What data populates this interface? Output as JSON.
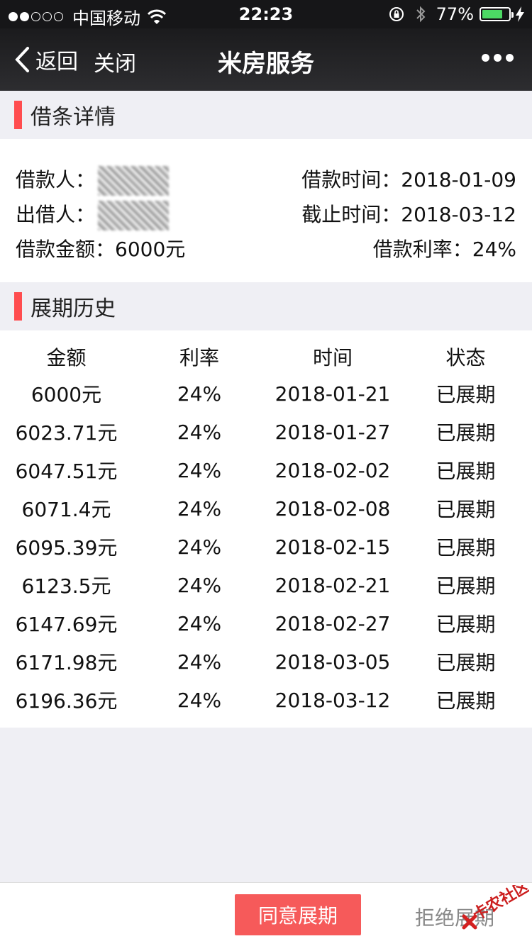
{
  "status_bar": {
    "carrier": "中国移动",
    "time": "22:23",
    "battery_percent": "77%",
    "battery_level": 0.77,
    "signal_strength": 2
  },
  "nav": {
    "back_label": "返回",
    "close_label": "关闭",
    "title": "米房服务",
    "more_icon": "more-icon"
  },
  "loan_detail": {
    "section_title": "借条详情",
    "borrower_label": "借款人：",
    "lender_label": "出借人：",
    "amount_label": "借款金额：",
    "amount_value": "6000元",
    "loan_time_label": "借款时间：",
    "loan_time_value": "2018-01-09",
    "deadline_label": "截止时间：",
    "deadline_value": "2018-03-12",
    "rate_label": "借款利率：",
    "rate_value": "24%"
  },
  "history": {
    "section_title": "展期历史",
    "columns": [
      "金额",
      "利率",
      "时间",
      "状态"
    ],
    "rows": [
      [
        "6000元",
        "24%",
        "2018-01-21",
        "已展期"
      ],
      [
        "6023.71元",
        "24%",
        "2018-01-27",
        "已展期"
      ],
      [
        "6047.51元",
        "24%",
        "2018-02-02",
        "已展期"
      ],
      [
        "6071.4元",
        "24%",
        "2018-02-08",
        "已展期"
      ],
      [
        "6095.39元",
        "24%",
        "2018-02-15",
        "已展期"
      ],
      [
        "6123.5元",
        "24%",
        "2018-02-21",
        "已展期"
      ],
      [
        "6147.69元",
        "24%",
        "2018-02-27",
        "已展期"
      ],
      [
        "6171.98元",
        "24%",
        "2018-03-05",
        "已展期"
      ],
      [
        "6196.36元",
        "24%",
        "2018-03-12",
        "已展期"
      ]
    ]
  },
  "actions": {
    "agree_label": "同意展期",
    "reject_label": "拒绝展期"
  },
  "watermark": {
    "text": "卡农社区"
  },
  "colors": {
    "accent": "#ff4d4f",
    "button": "#f65a5a",
    "nav_bg": "#1f1f21",
    "page_bg": "#efeff4"
  }
}
